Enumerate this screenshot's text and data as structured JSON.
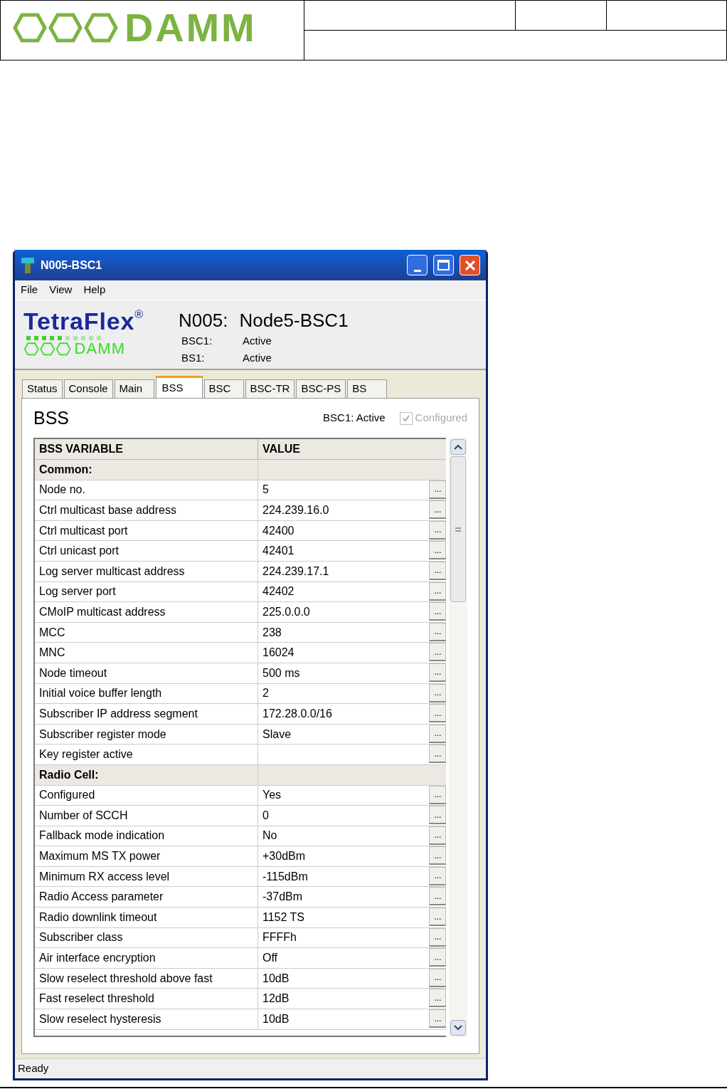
{
  "document_header": {
    "logo_text": "DAMM"
  },
  "window": {
    "title": "N005-BSC1",
    "menu": [
      "File",
      "View",
      "Help"
    ],
    "brand": {
      "name": "TetraFlex",
      "mark": "®",
      "sub": "DAMM"
    },
    "node": {
      "id": "N005:",
      "name": "Node5-BSC1",
      "statuses": [
        {
          "label": "BSC1:",
          "value": "Active"
        },
        {
          "label": "BS1:",
          "value": "Active"
        }
      ]
    },
    "tabs": [
      {
        "label": "Status",
        "selected": false
      },
      {
        "label": "Console",
        "selected": false
      },
      {
        "label": "Main",
        "selected": false
      },
      {
        "label": "BSS",
        "selected": true
      },
      {
        "label": "BSC",
        "selected": false
      },
      {
        "label": "BSC-TR",
        "selected": false
      },
      {
        "label": "BSC-PS",
        "selected": false
      },
      {
        "label": "BS",
        "selected": false
      }
    ],
    "panel": {
      "title": "BSS",
      "status": "BSC1: Active",
      "configured": {
        "label": "Configured",
        "checked": true,
        "disabled": true
      }
    },
    "table": {
      "columns": [
        "BSS VARIABLE",
        "VALUE"
      ],
      "rows": [
        {
          "kind": "section",
          "name": "Common:"
        },
        {
          "kind": "variable",
          "name": "Node no.",
          "value": "5"
        },
        {
          "kind": "variable",
          "name": "Ctrl multicast base address",
          "value": "224.239.16.0"
        },
        {
          "kind": "variable",
          "name": "Ctrl multicast port",
          "value": "42400"
        },
        {
          "kind": "variable",
          "name": "Ctrl unicast port",
          "value": "42401"
        },
        {
          "kind": "variable",
          "name": "Log server multicast address",
          "value": "224.239.17.1"
        },
        {
          "kind": "variable",
          "name": "Log server port",
          "value": "42402"
        },
        {
          "kind": "variable",
          "name": "CMoIP multicast address",
          "value": "225.0.0.0"
        },
        {
          "kind": "variable",
          "name": "MCC",
          "value": "238"
        },
        {
          "kind": "variable",
          "name": "MNC",
          "value": "16024"
        },
        {
          "kind": "variable",
          "name": "Node timeout",
          "value": "500 ms"
        },
        {
          "kind": "variable",
          "name": "Initial voice buffer length",
          "value": "2"
        },
        {
          "kind": "variable",
          "name": "Subscriber IP address segment",
          "value": "172.28.0.0/16"
        },
        {
          "kind": "variable",
          "name": "Subscriber register mode",
          "value": "Slave"
        },
        {
          "kind": "variable",
          "name": "Key register active"
        },
        {
          "kind": "section",
          "name": "Radio Cell:"
        },
        {
          "kind": "variable",
          "name": "Configured",
          "value": "Yes"
        },
        {
          "kind": "variable",
          "name": "Number of SCCH",
          "value": "0"
        },
        {
          "kind": "variable",
          "name": "Fallback mode indication",
          "value": "No"
        },
        {
          "kind": "variable",
          "name": "Maximum MS TX power",
          "value": "+30dBm"
        },
        {
          "kind": "variable",
          "name": "Minimum RX access level",
          "value": "-115dBm"
        },
        {
          "kind": "variable",
          "name": "Radio Access parameter",
          "value": "-37dBm"
        },
        {
          "kind": "variable",
          "name": "Radio downlink timeout",
          "value": "1152 TS"
        },
        {
          "kind": "variable",
          "name": "Subscriber class",
          "value": "FFFFh"
        },
        {
          "kind": "variable",
          "name": "Air interface encryption",
          "value": "Off"
        },
        {
          "kind": "variable",
          "name": "Slow reselect threshold above fast",
          "value": "10dB"
        },
        {
          "kind": "variable",
          "name": "Fast reselect threshold",
          "value": "12dB"
        },
        {
          "kind": "variable",
          "name": "Slow reselect hysteresis",
          "value": "10dB"
        }
      ],
      "edit_button": "..."
    },
    "status_bar": "Ready"
  }
}
